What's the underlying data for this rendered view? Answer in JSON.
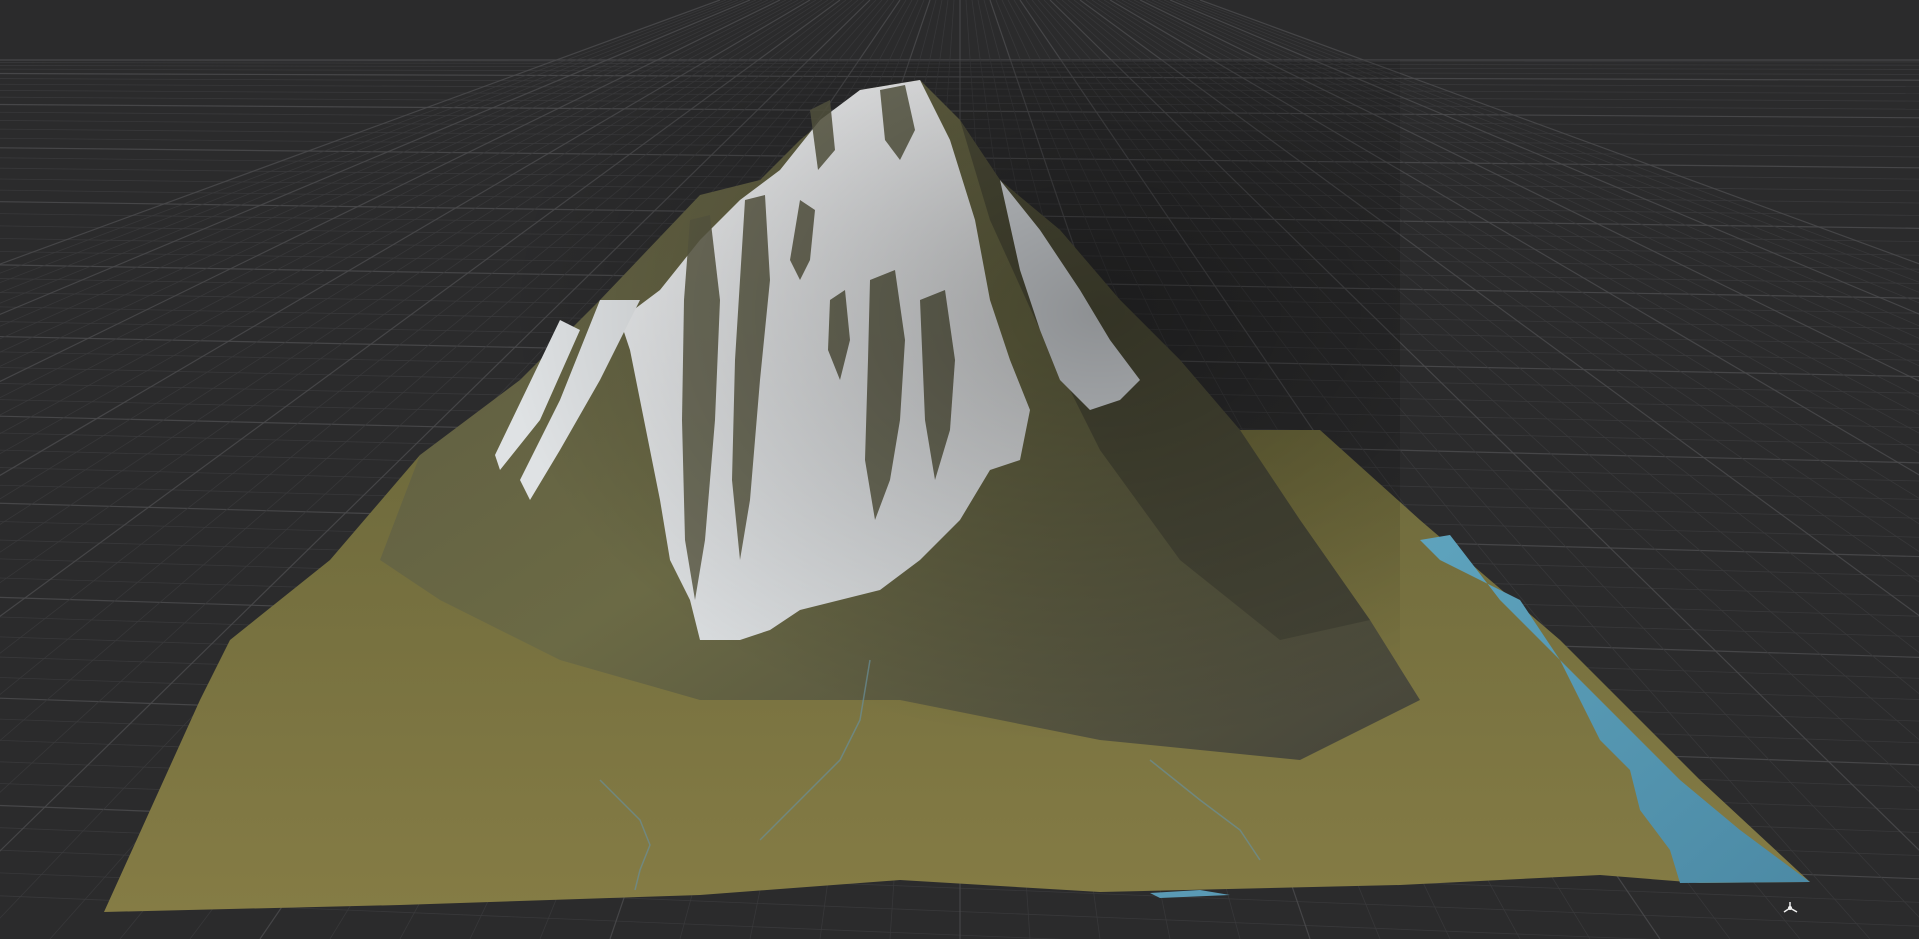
{
  "viewport": {
    "background_color": "#2b2b2c",
    "grid_color": "#4a4a4c",
    "grid_minor_color": "#3a3a3c"
  },
  "terrain": {
    "grass_color": "#7a7340",
    "rock_color": "#4d4c3a",
    "snow_color": "#e6e8ea",
    "water_color": "#5a9ab5"
  },
  "gizmo": {
    "icon": "axis-gizmo-icon"
  }
}
